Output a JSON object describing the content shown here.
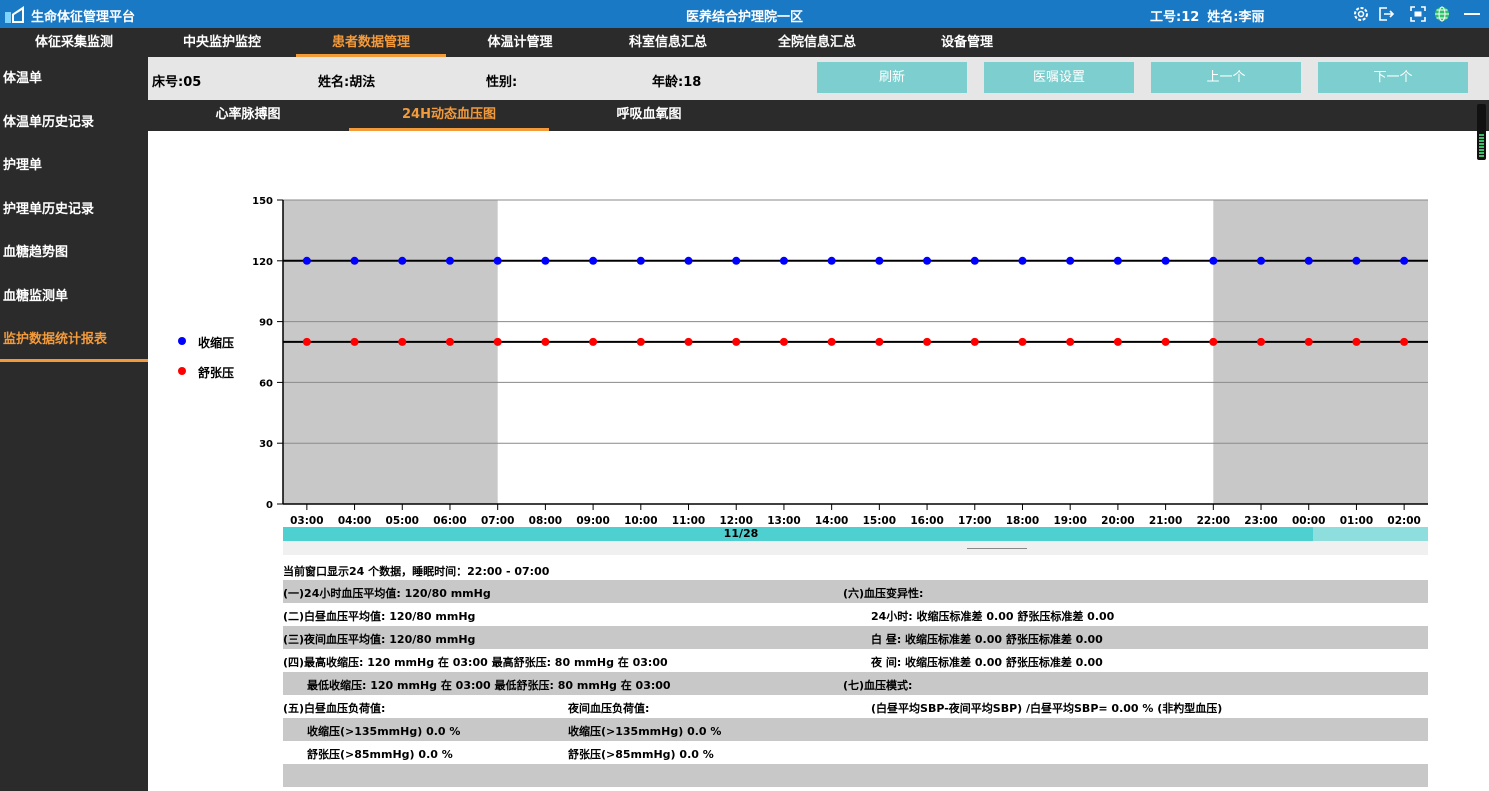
{
  "titlebar": {
    "app_title": "生命体征管理平台",
    "facility": "医养结合护理院一区",
    "staff_id": "工号:12",
    "staff_name": "姓名:李丽",
    "accent": "#1a79c4"
  },
  "topnav": {
    "tabs": [
      {
        "label": "体征采集监测"
      },
      {
        "label": "中央监护监控"
      },
      {
        "label": "患者数据管理",
        "active": true
      },
      {
        "label": "体温计管理"
      },
      {
        "label": "科室信息汇总"
      },
      {
        "label": "全院信息汇总"
      },
      {
        "label": "设备管理"
      }
    ]
  },
  "sidebar": {
    "items": [
      {
        "label": "体温单"
      },
      {
        "label": "体温单历史记录"
      },
      {
        "label": "护理单"
      },
      {
        "label": "护理单历史记录"
      },
      {
        "label": "血糖趋势图"
      },
      {
        "label": "血糖监测单"
      },
      {
        "label": "监护数据统计报表",
        "active": true
      }
    ]
  },
  "patient": {
    "bed": "床号:05",
    "name": "姓名:胡法",
    "gender": "性别:",
    "age": "年龄:18"
  },
  "actions": {
    "refresh": "刷新",
    "order_settings": "医嘱设置",
    "prev": "上一个",
    "next": "下一个"
  },
  "subtabs": [
    {
      "label": "心率脉搏图"
    },
    {
      "label": "24H动态血压图",
      "active": true
    },
    {
      "label": "呼吸血氧图"
    }
  ],
  "legend": [
    {
      "label": "收缩压",
      "color": "#0000ff"
    },
    {
      "label": "舒张压",
      "color": "#ff0000"
    }
  ],
  "chart_data": {
    "type": "scatter",
    "x": [
      "03:00",
      "04:00",
      "05:00",
      "06:00",
      "07:00",
      "08:00",
      "09:00",
      "10:00",
      "11:00",
      "12:00",
      "13:00",
      "14:00",
      "15:00",
      "16:00",
      "17:00",
      "18:00",
      "19:00",
      "20:00",
      "21:00",
      "22:00",
      "23:00",
      "00:00",
      "01:00",
      "02:00"
    ],
    "series": [
      {
        "name": "收缩压",
        "color": "#0000ff",
        "values": [
          120,
          120,
          120,
          120,
          120,
          120,
          120,
          120,
          120,
          120,
          120,
          120,
          120,
          120,
          120,
          120,
          120,
          120,
          120,
          120,
          120,
          120,
          120,
          120
        ]
      },
      {
        "name": "舒张压",
        "color": "#ff0000",
        "values": [
          80,
          80,
          80,
          80,
          80,
          80,
          80,
          80,
          80,
          80,
          80,
          80,
          80,
          80,
          80,
          80,
          80,
          80,
          80,
          80,
          80,
          80,
          80,
          80
        ]
      }
    ],
    "yticks": [
      0,
      30,
      60,
      90,
      120,
      150
    ],
    "ylim": [
      0,
      150
    ],
    "grid": true,
    "sleep_shading": {
      "from": "03:00",
      "to": "07:00",
      "resume": "22:00",
      "color": "#c8c8c8"
    },
    "reference_lines": [
      120,
      80
    ],
    "date_label": "11/28"
  },
  "stats": {
    "caption": "当前窗口显示24 个数据，睡眠时间：22:00 - 07:00",
    "rows": [
      {
        "gray": true,
        "cells": [
          "(一)24小时血压平均值: 120/80 mmHg",
          "",
          "(六)血压变异性:"
        ]
      },
      {
        "gray": false,
        "cells": [
          "(二)白昼血压平均值: 120/80 mmHg",
          "",
          "24小时: 收缩压标准差 0.00  舒张压标准差 0.00"
        ]
      },
      {
        "gray": true,
        "cells": [
          "(三)夜间血压平均值: 120/80 mmHg",
          "",
          "白  昼: 收缩压标准差 0.00  舒张压标准差 0.00"
        ]
      },
      {
        "gray": false,
        "cells": [
          "(四)最高收缩压: 120 mmHg 在 03:00   最高舒张压: 80 mmHg 在 03:00",
          "",
          "夜  间: 收缩压标准差 0.00  舒张压标准差 0.00"
        ]
      },
      {
        "gray": true,
        "cells": [
          "最低收缩压: 120 mmHg 在 03:00   最低舒张压: 80 mmHg 在 03:00",
          "",
          "(七)血压模式:"
        ]
      },
      {
        "gray": false,
        "cells": [
          "(五)白昼血压负荷值:",
          "夜间血压负荷值:",
          "(白昼平均SBP-夜间平均SBP) /白昼平均SBP= 0.00 %  (非杓型血压)"
        ]
      },
      {
        "gray": true,
        "cells": [
          "收缩压(>135mmHg) 0.0 %",
          "收缩压(>135mmHg) 0.0 %",
          ""
        ]
      },
      {
        "gray": false,
        "cells": [
          "舒张压(>85mmHg) 0.0 %",
          "舒张压(>85mmHg) 0.0 %",
          ""
        ]
      },
      {
        "gray": true,
        "cells": [
          "",
          "",
          ""
        ]
      }
    ]
  }
}
